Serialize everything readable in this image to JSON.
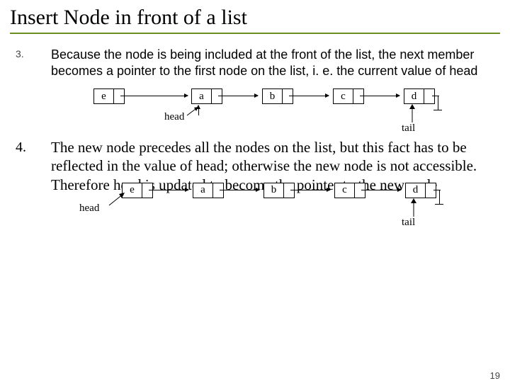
{
  "title": "Insert Node in front of a list",
  "item3": {
    "num": "3.",
    "text": "Because the node is being included at the front of the list, the next member becomes a pointer to the first node on the list, i. e. the current value of head"
  },
  "item4": {
    "num": "4.",
    "text": "The new node precedes all the nodes on the list, but this fact has to be reflected in the value of head; otherwise the new node is not accessible. Therefore head is updated to become the pointer to the new node"
  },
  "diagram1": {
    "nodes": [
      "e",
      "a",
      "b",
      "c",
      "d"
    ],
    "head": "head",
    "tail": "tail"
  },
  "diagram2": {
    "nodes": [
      "e",
      "a",
      "b",
      "c",
      "d"
    ],
    "head": "head",
    "tail": "tail"
  },
  "page": "19"
}
